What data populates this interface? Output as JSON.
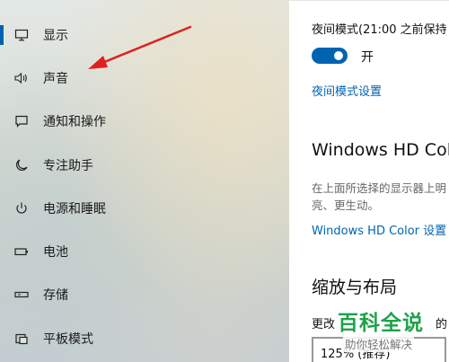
{
  "sidebar": {
    "items": [
      {
        "label": "显示",
        "icon": "monitor-icon",
        "selected": true
      },
      {
        "label": "声音",
        "icon": "speaker-icon",
        "selected": false
      },
      {
        "label": "通知和操作",
        "icon": "notification-icon",
        "selected": false
      },
      {
        "label": "专注助手",
        "icon": "moon-icon",
        "selected": false
      },
      {
        "label": "电源和睡眠",
        "icon": "power-icon",
        "selected": false
      },
      {
        "label": "电池",
        "icon": "battery-icon",
        "selected": false
      },
      {
        "label": "存储",
        "icon": "storage-icon",
        "selected": false
      },
      {
        "label": "平板模式",
        "icon": "tablet-mode-icon",
        "selected": false
      }
    ],
    "accent_color": "#0063b1",
    "annotation_arrow_color": "#e02020"
  },
  "content": {
    "night_light_label": "夜间模式(21:00 之前保持",
    "night_light_toggle_state": "开",
    "night_light_toggle_on": true,
    "night_light_settings_link": "夜间模式设置",
    "hd_color_title": "Windows HD Colo",
    "hd_color_description": "在上面所选择的显示器上明亮、更生动。",
    "hd_color_link": "Windows HD Color 设置",
    "scale_layout_title": "缩放与布局",
    "change_label_start": "更改",
    "change_label_end": "的",
    "scale_dropdown_value": "125% (推荐)"
  },
  "watermark": {
    "main": "百科全说",
    "sub": "助你轻松解决"
  }
}
